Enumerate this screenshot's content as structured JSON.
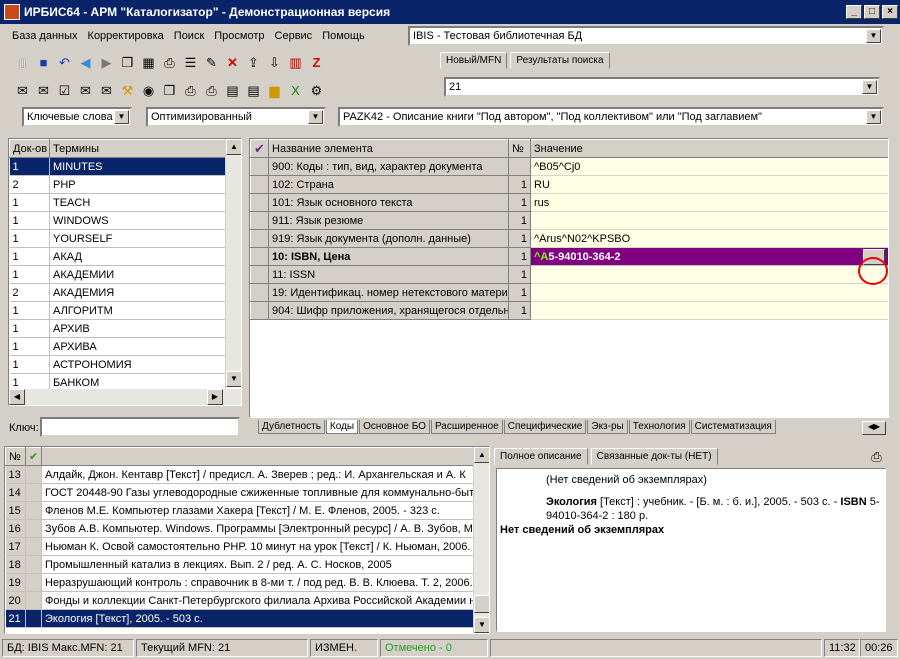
{
  "window": {
    "title": "ИРБИС64 - АРМ \"Каталогизатор\" - Демонстрационная версия"
  },
  "menu": [
    "База данных",
    "Корректировка",
    "Поиск",
    "Просмотр",
    "Сервис",
    "Помощь"
  ],
  "database": "IBIS - Тестовая библиотечная БД",
  "tabs_top": [
    "Новый/MFN",
    "Результаты поиска"
  ],
  "mfn_value": "21",
  "search": {
    "mode": "Ключевые слова",
    "method": "Оптимизированный",
    "worksheet": "PAZK42 - Описание книги \"Под автором\", \"Под коллективом\" или \"Под заглавием\""
  },
  "terms": {
    "col_docs": "Док-ов",
    "col_terms": "Термины",
    "key_label": "Ключ:",
    "key_value": "",
    "rows": [
      [
        "1",
        "MINUTES"
      ],
      [
        "2",
        "PHP"
      ],
      [
        "1",
        "TEACH"
      ],
      [
        "1",
        "WINDOWS"
      ],
      [
        "1",
        "YOURSELF"
      ],
      [
        "1",
        "АКАД"
      ],
      [
        "1",
        "АКАДЕМИИ"
      ],
      [
        "2",
        "АКАДЕМИЯ"
      ],
      [
        "1",
        "АЛГОРИТМ"
      ],
      [
        "1",
        "АРХИВ"
      ],
      [
        "1",
        "АРХИВА"
      ],
      [
        "1",
        "АСТРОНОМИЯ"
      ],
      [
        "1",
        "БАНКОМ"
      ]
    ]
  },
  "fields": {
    "col_name": "Название элемента",
    "col_num": "№",
    "col_value": "Значение",
    "rows": [
      [
        "900: Коды : тип, вид, характер документа",
        "",
        "^B05^Cj0"
      ],
      [
        "102: Страна",
        "1",
        "RU"
      ],
      [
        "101: Язык основного текста",
        "1",
        "rus"
      ],
      [
        "911: Язык резюме",
        "1",
        ""
      ],
      [
        "919: Язык документа (дополн. данные)",
        "1",
        "^Arus^N02^KPSBO"
      ],
      [
        "10: ISBN, Цена",
        "1",
        "5-94010-364-2"
      ],
      [
        "11: ISSN",
        "1",
        ""
      ],
      [
        "19: Идентификац. номер нетекстового матери",
        "1",
        ""
      ],
      [
        "904: Шифр приложения, хранящегося отдельно",
        "1",
        ""
      ]
    ],
    "selected_prefix": "^A",
    "edit_button": "..."
  },
  "worksheet_tabs": [
    "Дублетность",
    "Коды",
    "Основное БО",
    "Расширенное",
    "Специфические",
    "Экз-ры",
    "Технология",
    "Систематизация"
  ],
  "results": {
    "col_num": "№",
    "check": "✔",
    "rows": [
      [
        "13",
        "Алдайк, Джон. Кентавр [Текст] / предисл. А. Зверев ; ред.: И. Архангельская и А. К"
      ],
      [
        "14",
        "ГОСТ 20448-90 Газы углеводородные сжиженные топливные для коммунально-быт"
      ],
      [
        "15",
        "Фленов М.Е. Компьютер глазами Хакера [Текст] / М. Е. Фленов, 2005. - 323 с."
      ],
      [
        "16",
        "Зубов А.В. Компьютер. Windows. Программы [Электронный ресурс] / А. В. Зубов, М"
      ],
      [
        "17",
        "Ньюман К. Освой самостоятельно PHP. 10 минут на урок [Текст] / К. Ньюман, 2006."
      ],
      [
        "18",
        "Промышленный катализ в лекциях. Вып. 2 / ред. А. С. Носков, 2005"
      ],
      [
        "19",
        "Неразрушающий контроль : справочник в 8-ми т. / под ред. В. В. Клюева. Т. 2, 2006."
      ],
      [
        "20",
        "Фонды и коллекции Санкт-Петербургского филиала Архива Российской Академии н"
      ],
      [
        "21",
        "Экология [Текст], 2005. - 503 с."
      ]
    ]
  },
  "desc_tabs": [
    "Полное описание",
    "Связанные док-ты (НЕТ)"
  ],
  "description": {
    "line1": "(Нет сведений об экземплярах)",
    "title": "Экология",
    "body": " [Текст] : учебник. - [Б. м. : б. и.], 2005. - 503 с. - ",
    "isbn_label": "ISBN",
    "isbn": " 5-94010-364-2 : 180 р.",
    "footer": "Нет сведений об экземплярах"
  },
  "status": {
    "db": "БД: IBIS Макс.MFN: 21",
    "current": "Текущий MFN: 21",
    "changed": "ИЗМЕН.",
    "marked": "Отмечено - 0",
    "time": "11:32",
    "date": "00:26"
  }
}
